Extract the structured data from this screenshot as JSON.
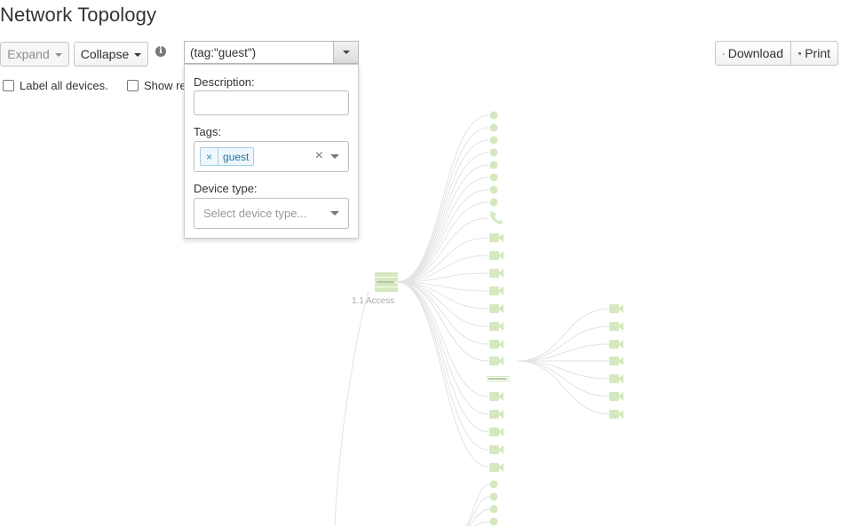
{
  "page": {
    "title": "Network Topology"
  },
  "toolbar": {
    "expand_label": "Expand",
    "collapse_label": "Collapse",
    "download_label": "Download",
    "print_label": "Print"
  },
  "search": {
    "value": "(tag:\"guest\")"
  },
  "filter_panel": {
    "description_label": "Description:",
    "description_value": "",
    "tags_label": "Tags:",
    "tags": [
      "guest"
    ],
    "device_type_label": "Device type:",
    "device_type_placeholder": "Select device type..."
  },
  "options": {
    "label_all_devices": "Label all devices.",
    "label_all_checked": false,
    "show_re": "Show re",
    "show_re_checked": false
  },
  "topology": {
    "node_label": "1.1 Access",
    "color": "#d4e9bf",
    "line_color": "#e3e3e3",
    "main_branch": [
      "dot",
      "dot",
      "dot",
      "dot",
      "dot",
      "dot",
      "dot",
      "dot",
      "phone",
      "camera",
      "camera",
      "camera",
      "camera",
      "camera",
      "camera",
      "camera",
      "camera",
      "switch",
      "camera",
      "camera",
      "camera",
      "camera",
      "camera"
    ],
    "sub_branch": [
      "camera",
      "camera",
      "camera",
      "camera",
      "camera",
      "camera",
      "camera"
    ],
    "lower_branch": [
      "dot",
      "dot",
      "dot",
      "dot"
    ]
  }
}
